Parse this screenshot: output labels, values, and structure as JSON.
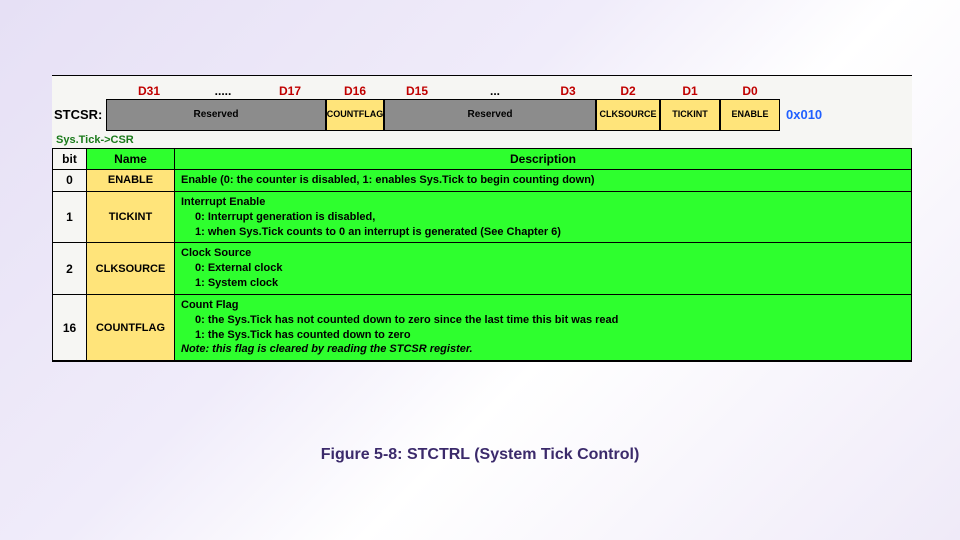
{
  "bit_labels": {
    "d31": "D31",
    "dots1": ".....",
    "d17": "D17",
    "d16": "D16",
    "d15": "D15",
    "dots2": "...",
    "d3": "D3",
    "d2": "D2",
    "d1": "D1",
    "d0": "D0"
  },
  "register": {
    "label": "STCSR:",
    "fields": {
      "reserved_hi": "Reserved",
      "countflag": "COUNTFLAG",
      "reserved_lo": "Reserved",
      "clksource": "CLKSOURCE",
      "tickint": "TICKINT",
      "enable": "ENABLE"
    },
    "address": "0x010"
  },
  "csr_label": "Sys.Tick->CSR",
  "table": {
    "headers": {
      "bit": "bit",
      "name": "Name",
      "desc": "Description"
    },
    "rows": [
      {
        "bit": "0",
        "name": "ENABLE",
        "title": "Enable (0: the counter is disabled, 1: enables Sys.Tick to begin counting down)"
      },
      {
        "bit": "1",
        "name": "TICKINT",
        "title": "Interrupt Enable",
        "l1": "0: Interrupt generation is disabled,",
        "l2": "1: when Sys.Tick counts to 0 an interrupt is generated (See Chapter 6)"
      },
      {
        "bit": "2",
        "name": "CLKSOURCE",
        "title": "Clock Source",
        "l1": "0: External clock",
        "l2": "1: System clock"
      },
      {
        "bit": "16",
        "name": "COUNTFLAG",
        "title": "Count Flag",
        "l1": "0: the Sys.Tick has not counted down to zero since the last time this bit was read",
        "l2": "1: the Sys.Tick has counted down to zero",
        "note": "Note: this flag is cleared by reading the STCSR register."
      }
    ]
  },
  "caption": "Figure 5-8: STCTRL (System Tick Control)"
}
